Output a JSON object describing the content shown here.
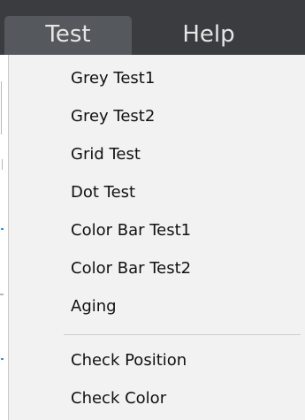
{
  "menubar": {
    "tabs": [
      {
        "label": "Test",
        "active": true
      },
      {
        "label": "Help",
        "active": false
      }
    ]
  },
  "dropdown": {
    "items": [
      {
        "label": "Grey Test1"
      },
      {
        "label": "Grey Test2"
      },
      {
        "label": "Grid Test"
      },
      {
        "label": "Dot Test"
      },
      {
        "label": "Color Bar Test1"
      },
      {
        "label": "Color Bar Test2"
      },
      {
        "label": "Aging"
      },
      {
        "label": "Check Position"
      },
      {
        "label": "Check Color"
      }
    ]
  },
  "colors": {
    "menubar_bg": "#3a3c3f",
    "active_tab_bg": "#55585c",
    "menu_bg": "#f2f2f2",
    "accent_blue": "#3c8fd0"
  }
}
